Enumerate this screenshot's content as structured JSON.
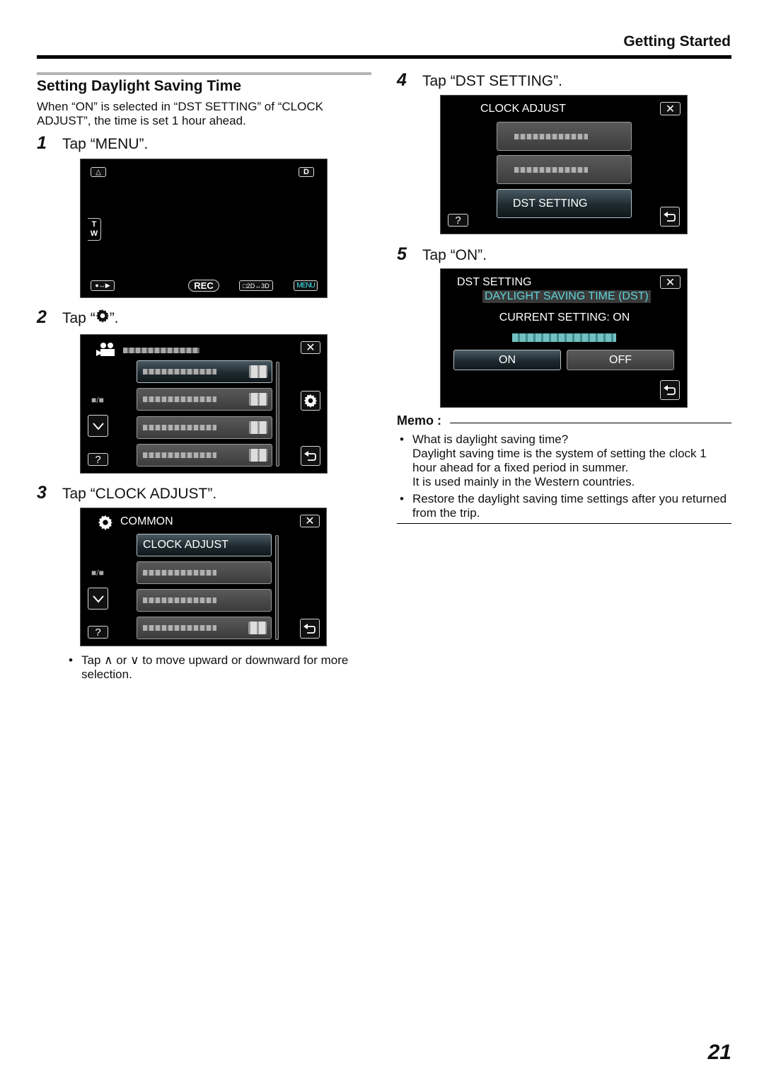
{
  "header": {
    "section": "Getting Started"
  },
  "section_title": "Setting Daylight Saving Time",
  "intro": "When “ON” is selected in “DST SETTING” of “CLOCK ADJUST”, the time is set 1 hour ahead.",
  "steps": [
    {
      "num": "1",
      "text": "Tap “MENU”."
    },
    {
      "num": "2",
      "text_before": "Tap “",
      "icon": "gear-icon",
      "text_after": "”."
    },
    {
      "num": "3",
      "text": "Tap “CLOCK ADJUST”."
    },
    {
      "num": "4",
      "text": "Tap “DST SETTING”."
    },
    {
      "num": "5",
      "text": "Tap “ON”."
    }
  ],
  "screen1": {
    "top_left_icon": "warning-icon",
    "top_right": "D",
    "zoom_t": "T",
    "zoom_w": "W",
    "mode_icon": "record-play-toggle-icon",
    "rec": "REC",
    "mode_2d3d": "□2D↔3D",
    "menu": "MENU"
  },
  "screen2": {
    "header_icon": "movie-camera-icon",
    "page_indicator": "■/■",
    "items_count": 4
  },
  "screen3": {
    "title": "COMMON",
    "items": [
      "CLOCK ADJUST",
      "",
      "",
      ""
    ],
    "page_indicator": "■/■"
  },
  "screen4": {
    "title": "CLOCK ADJUST",
    "items": [
      "",
      "",
      "DST SETTING"
    ]
  },
  "screen5": {
    "title": "DST SETTING",
    "subtitle": "DAYLIGHT SAVING TIME (DST)",
    "current": "CURRENT SETTING: ON",
    "on": "ON",
    "off": "OFF"
  },
  "step3_note": "Tap ∧ or ∨ to move upward or downward for more selection.",
  "memo": {
    "title": "Memo :",
    "bullets": [
      "What is daylight saving time?\nDaylight saving time is the system of setting the clock 1 hour ahead for a fixed period in summer.\nIt is used mainly in the Western countries.",
      "Restore the daylight saving time settings after you returned from the trip."
    ]
  },
  "page_number": "21",
  "colors": {
    "accent_cyan": "#5fd3d8",
    "selected_bg": "#1e2a30"
  }
}
